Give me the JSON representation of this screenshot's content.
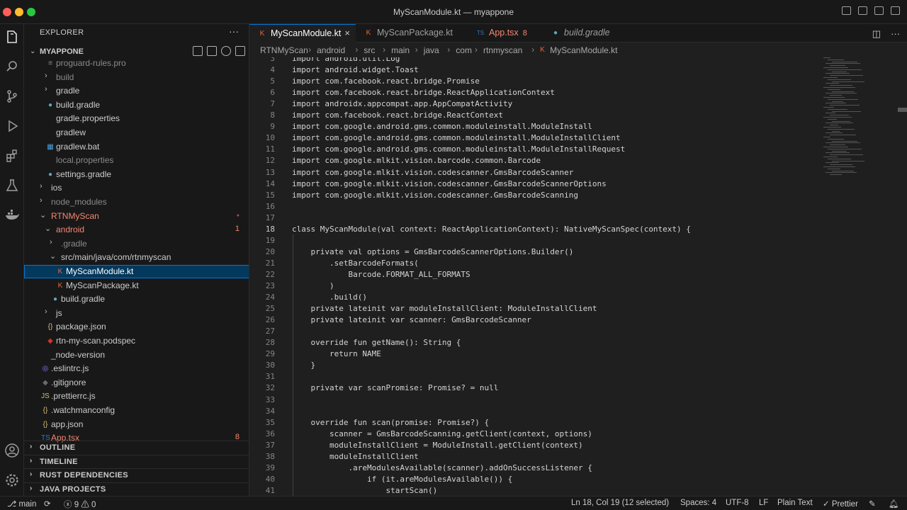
{
  "window": {
    "title": "MyScanModule.kt — myappone"
  },
  "explorer": {
    "title": "EXPLORER",
    "more": "···",
    "project": "MYAPPONE"
  },
  "tree": [
    {
      "label": "proguard-rules.pro",
      "depth": 1,
      "kind": "file",
      "color": "#8a8a8a",
      "icon": "file"
    },
    {
      "label": "build",
      "depth": 1,
      "kind": "folder",
      "color": "#8a8a8a"
    },
    {
      "label": "gradle",
      "depth": 1,
      "kind": "folder",
      "color": "#cccccc"
    },
    {
      "label": "build.gradle",
      "depth": 1,
      "kind": "file",
      "color": "#cccccc",
      "icon": "elephant"
    },
    {
      "label": "gradle.properties",
      "depth": 1,
      "kind": "file",
      "color": "#cccccc",
      "icon": "none"
    },
    {
      "label": "gradlew",
      "depth": 1,
      "kind": "file",
      "color": "#cccccc",
      "icon": "none"
    },
    {
      "label": "gradlew.bat",
      "depth": 1,
      "kind": "file",
      "color": "#cccccc",
      "icon": "windows"
    },
    {
      "label": "local.properties",
      "depth": 1,
      "kind": "file",
      "color": "#8a8a8a",
      "icon": "none"
    },
    {
      "label": "settings.gradle",
      "depth": 1,
      "kind": "file",
      "color": "#cccccc",
      "icon": "elephant"
    },
    {
      "label": "ios",
      "depth": 0,
      "kind": "folder",
      "color": "#cccccc"
    },
    {
      "label": "node_modules",
      "depth": 0,
      "kind": "folder",
      "color": "#8a8a8a"
    },
    {
      "label": "RTNMyScan",
      "depth": 0,
      "kind": "folder-open",
      "color": "#f48771",
      "dot": true
    },
    {
      "label": "android",
      "depth": 1,
      "kind": "folder-open",
      "color": "#f48771",
      "badge": "1"
    },
    {
      "label": ".gradle",
      "depth": 2,
      "kind": "folder",
      "color": "#8a8a8a"
    },
    {
      "label": "src/main/java/com/rtnmyscan",
      "depth": 2,
      "kind": "folder-open",
      "color": "#cccccc"
    },
    {
      "label": "MyScanModule.kt",
      "depth": 3,
      "kind": "file",
      "color": "#ffffff",
      "icon": "kotlin",
      "selected": true
    },
    {
      "label": "MyScanPackage.kt",
      "depth": 3,
      "kind": "file",
      "color": "#cccccc",
      "icon": "kotlin"
    },
    {
      "label": "build.gradle",
      "depth": 2,
      "kind": "file",
      "color": "#cccccc",
      "icon": "elephant"
    },
    {
      "label": "js",
      "depth": 1,
      "kind": "folder",
      "color": "#cccccc"
    },
    {
      "label": "package.json",
      "depth": 1,
      "kind": "file",
      "color": "#cccccc",
      "icon": "json"
    },
    {
      "label": "rtn-my-scan.podspec",
      "depth": 1,
      "kind": "file",
      "color": "#cccccc",
      "icon": "ruby"
    },
    {
      "label": "_node-version",
      "depth": 0,
      "kind": "file",
      "color": "#cccccc",
      "icon": "none"
    },
    {
      "label": ".eslintrc.js",
      "depth": 0,
      "kind": "file",
      "color": "#cccccc",
      "icon": "eslint"
    },
    {
      "label": ".gitignore",
      "depth": 0,
      "kind": "file",
      "color": "#cccccc",
      "icon": "git"
    },
    {
      "label": ".prettierrc.js",
      "depth": 0,
      "kind": "file",
      "color": "#cccccc",
      "icon": "js"
    },
    {
      "label": ".watchmanconfig",
      "depth": 0,
      "kind": "file",
      "color": "#cccccc",
      "icon": "json"
    },
    {
      "label": "app.json",
      "depth": 0,
      "kind": "file",
      "color": "#cccccc",
      "icon": "json"
    },
    {
      "label": "App.tsx",
      "depth": 0,
      "kind": "file",
      "color": "#f48771",
      "icon": "ts",
      "badge": "8"
    }
  ],
  "sections": [
    "OUTLINE",
    "TIMELINE",
    "RUST DEPENDENCIES",
    "JAVA PROJECTS"
  ],
  "tabs": [
    {
      "label": "MyScanModule.kt",
      "icon": "kotlin",
      "active": true,
      "close": "×"
    },
    {
      "label": "MyScanPackage.kt",
      "icon": "kotlin"
    },
    {
      "label": "App.tsx",
      "icon": "ts",
      "badge": "8",
      "color": "#f48771"
    },
    {
      "label": "build.gradle",
      "icon": "elephant",
      "italic": true
    }
  ],
  "breadcrumb": [
    "RTNMyScan",
    "android",
    "src",
    "main",
    "java",
    "com",
    "rtnmyscan",
    "MyScanModule.kt"
  ],
  "code": {
    "current_line": 18,
    "lines": [
      {
        "n": 3,
        "text": "import android.util.Log"
      },
      {
        "n": 4,
        "text": "import android.widget.Toast"
      },
      {
        "n": 5,
        "text": "import com.facebook.react.bridge.Promise"
      },
      {
        "n": 6,
        "text": "import com.facebook.react.bridge.ReactApplicationContext"
      },
      {
        "n": 7,
        "text": "import androidx.appcompat.app.AppCompatActivity"
      },
      {
        "n": 8,
        "text": "import com.facebook.react.bridge.ReactContext"
      },
      {
        "n": 9,
        "text": "import com.google.android.gms.common.moduleinstall.ModuleInstall"
      },
      {
        "n": 10,
        "text": "import com.google.android.gms.common.moduleinstall.ModuleInstallClient"
      },
      {
        "n": 11,
        "text": "import com.google.android.gms.common.moduleinstall.ModuleInstallRequest"
      },
      {
        "n": 12,
        "text": "import com.google.mlkit.vision.barcode.common.Barcode"
      },
      {
        "n": 13,
        "text": "import com.google.mlkit.vision.codescanner.GmsBarcodeScanner"
      },
      {
        "n": 14,
        "text": "import com.google.mlkit.vision.codescanner.GmsBarcodeScannerOptions"
      },
      {
        "n": 15,
        "text": "import com.google.mlkit.vision.codescanner.GmsBarcodeScanning"
      },
      {
        "n": 16,
        "text": ""
      },
      {
        "n": 17,
        "text": ""
      },
      {
        "n": 18,
        "text": "class MyScanModule(val context: ReactApplicationContext): NativeMyScanSpec(context) {"
      },
      {
        "n": 19,
        "text": ""
      },
      {
        "n": 20,
        "text": "    private val options = GmsBarcodeScannerOptions.Builder()"
      },
      {
        "n": 21,
        "text": "        .setBarcodeFormats("
      },
      {
        "n": 22,
        "text": "            Barcode.FORMAT_ALL_FORMATS"
      },
      {
        "n": 23,
        "text": "        )"
      },
      {
        "n": 24,
        "text": "        .build()"
      },
      {
        "n": 25,
        "text": "    private lateinit var moduleInstallClient: ModuleInstallClient"
      },
      {
        "n": 26,
        "text": "    private lateinit var scanner: GmsBarcodeScanner"
      },
      {
        "n": 27,
        "text": ""
      },
      {
        "n": 28,
        "text": "    override fun getName(): String {"
      },
      {
        "n": 29,
        "text": "        return NAME"
      },
      {
        "n": 30,
        "text": "    }"
      },
      {
        "n": 31,
        "text": ""
      },
      {
        "n": 32,
        "text": "    private var scanPromise: Promise? = null"
      },
      {
        "n": 33,
        "text": ""
      },
      {
        "n": 34,
        "text": ""
      },
      {
        "n": 35,
        "text": "    override fun scan(promise: Promise?) {"
      },
      {
        "n": 36,
        "text": "        scanner = GmsBarcodeScanning.getClient(context, options)"
      },
      {
        "n": 37,
        "text": "        moduleInstallClient = ModuleInstall.getClient(context)"
      },
      {
        "n": 38,
        "text": "        moduleInstallClient"
      },
      {
        "n": 39,
        "text": "            .areModulesAvailable(scanner).addOnSuccessListener {"
      },
      {
        "n": 40,
        "text": "                if (it.areModulesAvailable()) {"
      },
      {
        "n": 41,
        "text": "                    startScan()"
      }
    ]
  },
  "status": {
    "branch": "main",
    "sync": "⟳",
    "errors": "9",
    "warnings": "0",
    "position": "Ln 18, Col 19 (12 selected)",
    "spaces": "Spaces: 4",
    "encoding": "UTF-8",
    "eol": "LF",
    "language": "Plain Text",
    "prettier": "✓ Prettier"
  },
  "colors": {
    "accent": "#0078d4",
    "modified": "#f48771",
    "kotlin": "#e8663d",
    "ts": "#3178c6",
    "gradle": "#5fa8b8",
    "json": "#d7ba7d"
  }
}
